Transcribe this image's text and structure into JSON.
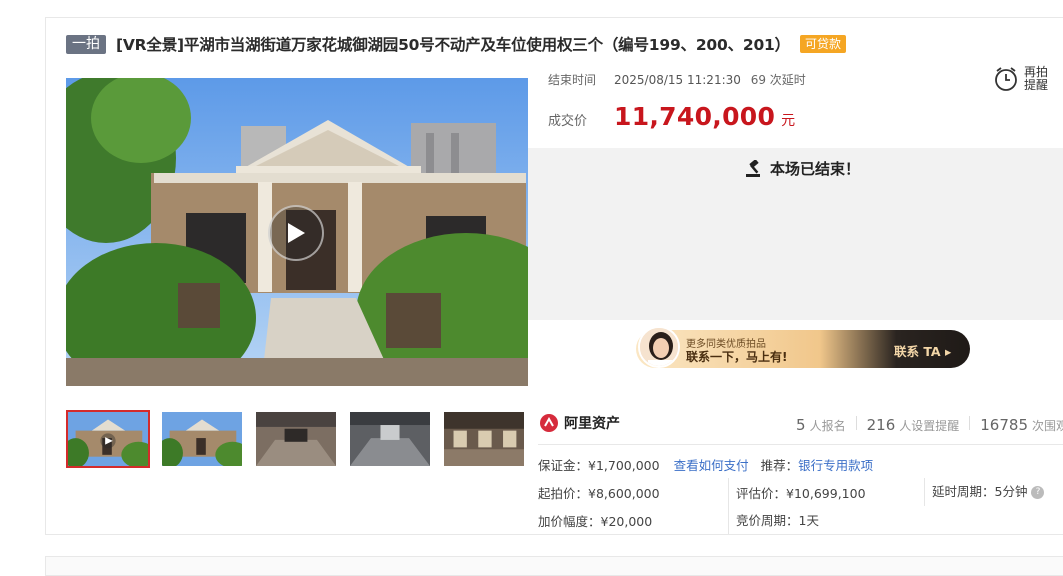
{
  "title": {
    "tag": "一拍",
    "text": "[VR全景]平湖市当湖街道万家花城御湖园50号不动产及车位使用权三个（编号199、200、201）",
    "loan_badge": "可贷款"
  },
  "auction": {
    "end_label": "结束时间",
    "end_time": "2025/08/15 11:21:30",
    "delay_text": "69 次延时",
    "price_label": "成交价",
    "price_value": "11,740,000",
    "price_unit": "元",
    "ended_text": "本场已结束！"
  },
  "remind": {
    "line1": "再拍",
    "line2": "提醒"
  },
  "banner": {
    "small": "更多同类优质拍品",
    "big": "联系一下，马上有!",
    "cta": "联系 TA"
  },
  "org": {
    "name": "阿里资产"
  },
  "stats": {
    "signups": "5",
    "signups_label": "人报名",
    "reminders": "216",
    "reminders_label": "人设置提醒",
    "views": "16785",
    "views_label": "次围观"
  },
  "details": {
    "deposit": "保证金：¥1,700,000",
    "pay_link": "查看如何支付",
    "recommend_label": "推荐：",
    "recommend_link": "银行专用款项",
    "start_price": "起拍价：¥8,600,000",
    "appraisal": "评估价：¥10,699,100",
    "delay_period": "延时周期：5分钟",
    "increment": "加价幅度：¥20,000",
    "bid_period": "竞价周期：1天"
  },
  "colors": {
    "price_red": "#c8161d",
    "link_blue": "#3b6fc7",
    "badge_orange": "#f5a623",
    "tag_gray": "#6b7383"
  }
}
